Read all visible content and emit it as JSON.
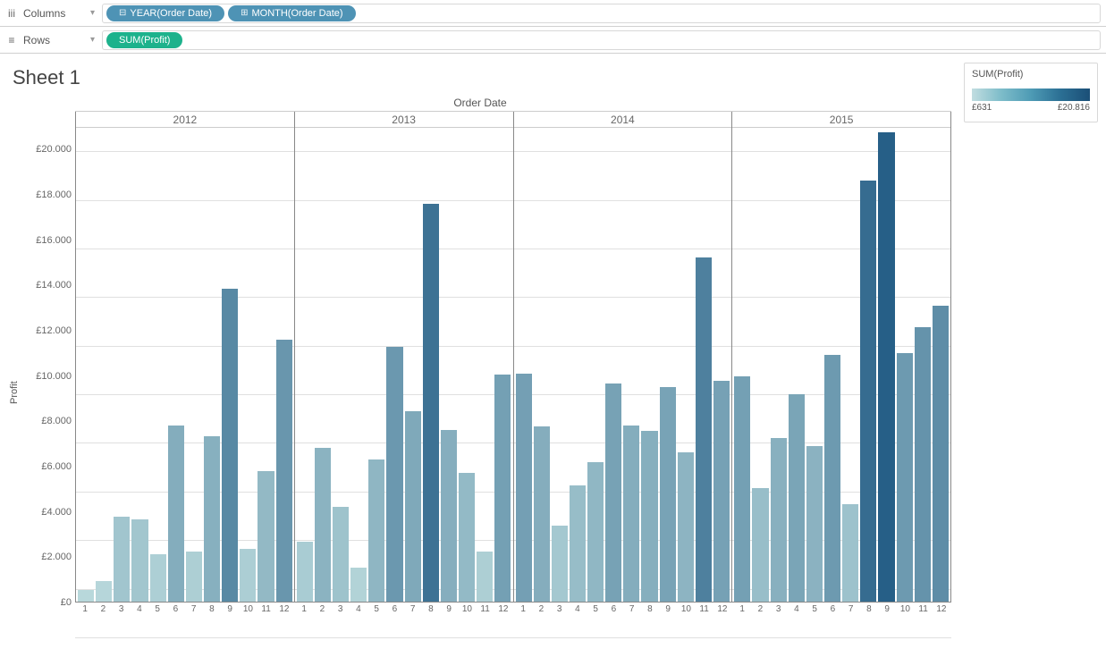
{
  "shelves": {
    "columns_label": "Columns",
    "rows_label": "Rows",
    "columns_pills": [
      {
        "icon": "⊟",
        "label": "YEAR(Order Date)"
      },
      {
        "icon": "⊞",
        "label": "MONTH(Order Date)"
      }
    ],
    "rows_pills": [
      {
        "icon": "",
        "label": "SUM(Profit)"
      }
    ]
  },
  "sheet_title": "Sheet 1",
  "legend": {
    "title": "SUM(Profit)",
    "min": "£631",
    "max": "£20.816"
  },
  "chart_data": {
    "type": "bar",
    "title": "Order Date",
    "ylabel": "Profit",
    "ylim": [
      0,
      21000
    ],
    "y_ticks": [
      "£0",
      "£2.000",
      "£4.000",
      "£6.000",
      "£8.000",
      "£10.000",
      "£12.000",
      "£14.000",
      "£16.000",
      "£18.000",
      "£20.000"
    ],
    "years": [
      "2012",
      "2013",
      "2014",
      "2015"
    ],
    "months": [
      "1",
      "2",
      "3",
      "4",
      "5",
      "6",
      "7",
      "8",
      "9",
      "10",
      "11",
      "12"
    ],
    "color_scale": {
      "min": 631,
      "max": 20816
    },
    "series": [
      {
        "name": "2012",
        "values": [
          500,
          900,
          3750,
          3650,
          2100,
          7800,
          2200,
          7350,
          13850,
          2350,
          5800,
          11600
        ]
      },
      {
        "name": "2013",
        "values": [
          2650,
          6800,
          4200,
          1500,
          6300,
          11300,
          8450,
          17650,
          7600,
          5700,
          2200,
          10050
        ]
      },
      {
        "name": "2014",
        "values": [
          10100,
          7750,
          3350,
          5150,
          6200,
          9650,
          7800,
          7550,
          9500,
          6600,
          15250,
          9800
        ]
      },
      {
        "name": "2015",
        "values": [
          10000,
          5050,
          7250,
          9200,
          6900,
          10950,
          4300,
          18650,
          20816,
          11000,
          12150,
          13100
        ]
      }
    ]
  }
}
